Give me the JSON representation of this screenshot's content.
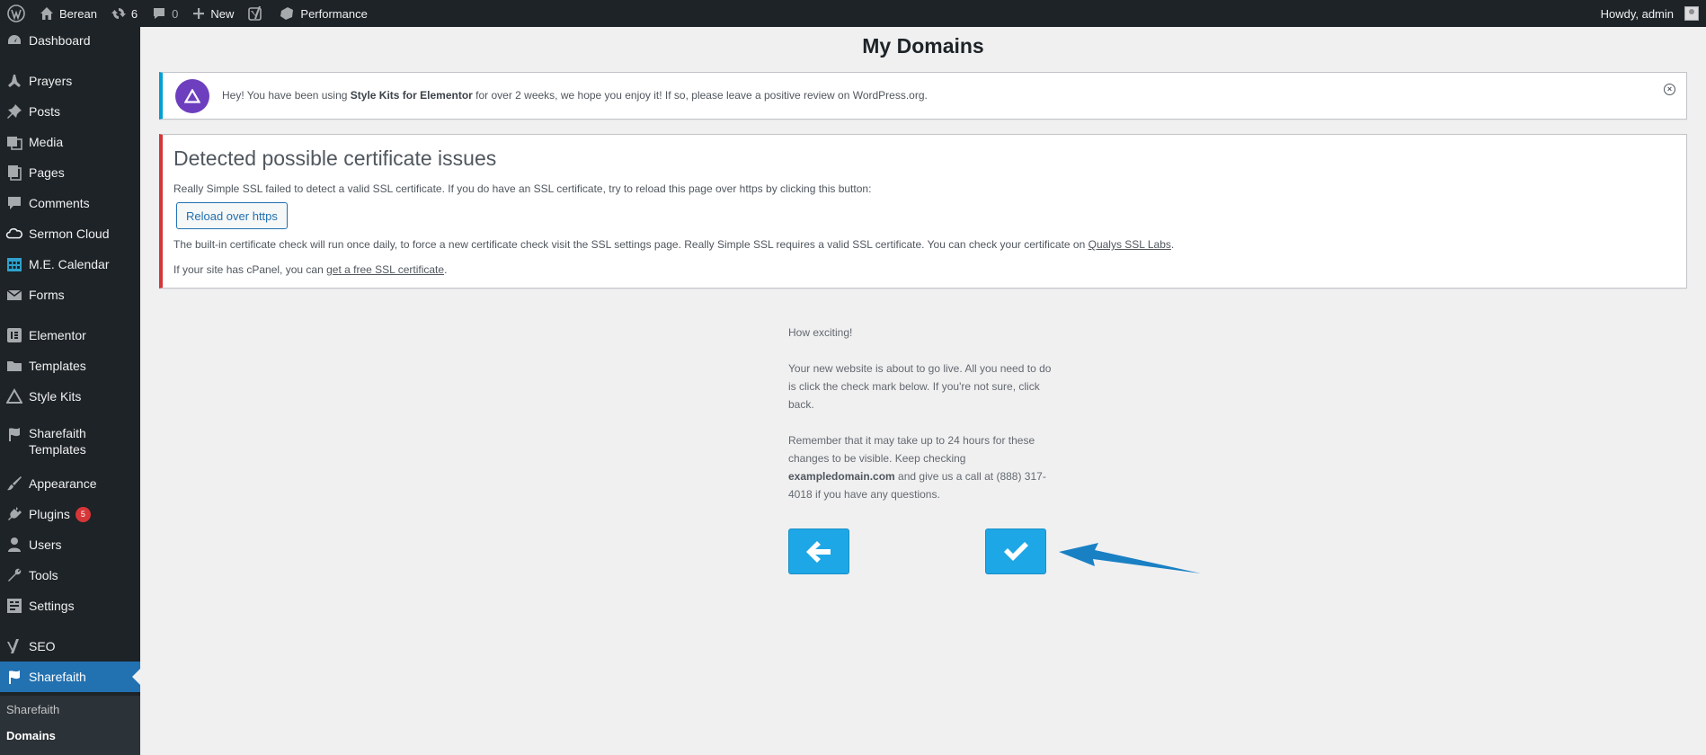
{
  "adminbar": {
    "site_name": "Berean",
    "updates_count": "6",
    "comments_count": "0",
    "new_label": "New",
    "performance_label": "Performance",
    "howdy": "Howdy, admin"
  },
  "sidebar": {
    "items": [
      {
        "label": "Dashboard",
        "icon": "dashboard-icon"
      },
      {
        "label": "Prayers",
        "icon": "prayers-icon"
      },
      {
        "label": "Posts",
        "icon": "pin-icon"
      },
      {
        "label": "Media",
        "icon": "media-icon"
      },
      {
        "label": "Pages",
        "icon": "pages-icon"
      },
      {
        "label": "Comments",
        "icon": "comment-icon"
      },
      {
        "label": "Sermon Cloud",
        "icon": "cloud-icon"
      },
      {
        "label": "M.E. Calendar",
        "icon": "calendar-icon"
      },
      {
        "label": "Forms",
        "icon": "mail-icon"
      },
      {
        "label": "Elementor",
        "icon": "elementor-icon"
      },
      {
        "label": "Templates",
        "icon": "folder-icon"
      },
      {
        "label": "Style Kits",
        "icon": "triangle-icon"
      },
      {
        "label": "Sharefaith",
        "label2": "Templates",
        "icon": "sharefaith-icon"
      },
      {
        "label": "Appearance",
        "icon": "brush-icon"
      },
      {
        "label": "Plugins",
        "icon": "plug-icon",
        "badge": "5"
      },
      {
        "label": "Users",
        "icon": "user-icon"
      },
      {
        "label": "Tools",
        "icon": "wrench-icon"
      },
      {
        "label": "Settings",
        "icon": "settings-icon"
      },
      {
        "label": "SEO",
        "icon": "yoast-icon"
      },
      {
        "label": "Sharefaith",
        "icon": "sharefaith-icon"
      }
    ],
    "submenu": [
      "Sharefaith",
      "Domains"
    ]
  },
  "main": {
    "title": "My Domains",
    "stylekits_notice": {
      "text_before": "Hey! You have been using ",
      "bold": "Style Kits for Elementor",
      "text_after": " for over 2 weeks, we hope you enjoy it! If so, please leave a positive review on WordPress.org."
    },
    "ssl_notice": {
      "title": "Detected possible certificate issues",
      "line1": "Really Simple SSL failed to detect a valid SSL certificate. If you do have an SSL certificate, try to reload this page over https by clicking this button:",
      "reload_button": "Reload over https",
      "line2": "The built-in certificate check will run once daily, to force a new certificate check visit the SSL settings page. Really Simple SSL requires a valid SSL certificate. You can check your certificate on ",
      "line2_link": "Qualys SSL Labs",
      "line2_end": ".",
      "line3": "If your site has cPanel, you can ",
      "line3_link": "get a free SSL certificate",
      "line3_end": "."
    },
    "wizard": {
      "p1": "How exciting!",
      "p2": "Your new website is about to go live. All you need to do is click the check mark below. If you're not sure, click back.",
      "p3_before": "Remember that it may take up to 24 hours for these changes to be visible. Keep checking ",
      "p3_bold": "exampledomain.com",
      "p3_after": " and give us a call at (888) 317-4018 if you have any questions."
    }
  },
  "colors": {
    "admin_dark": "#1d2327",
    "active_blue": "#2271b1",
    "button_blue": "#1ea7e6",
    "arrow_blue": "#1a80c4",
    "error_red": "#d63638",
    "info_blue": "#00a0d2",
    "stylekits_purple": "#6d3fbf"
  }
}
